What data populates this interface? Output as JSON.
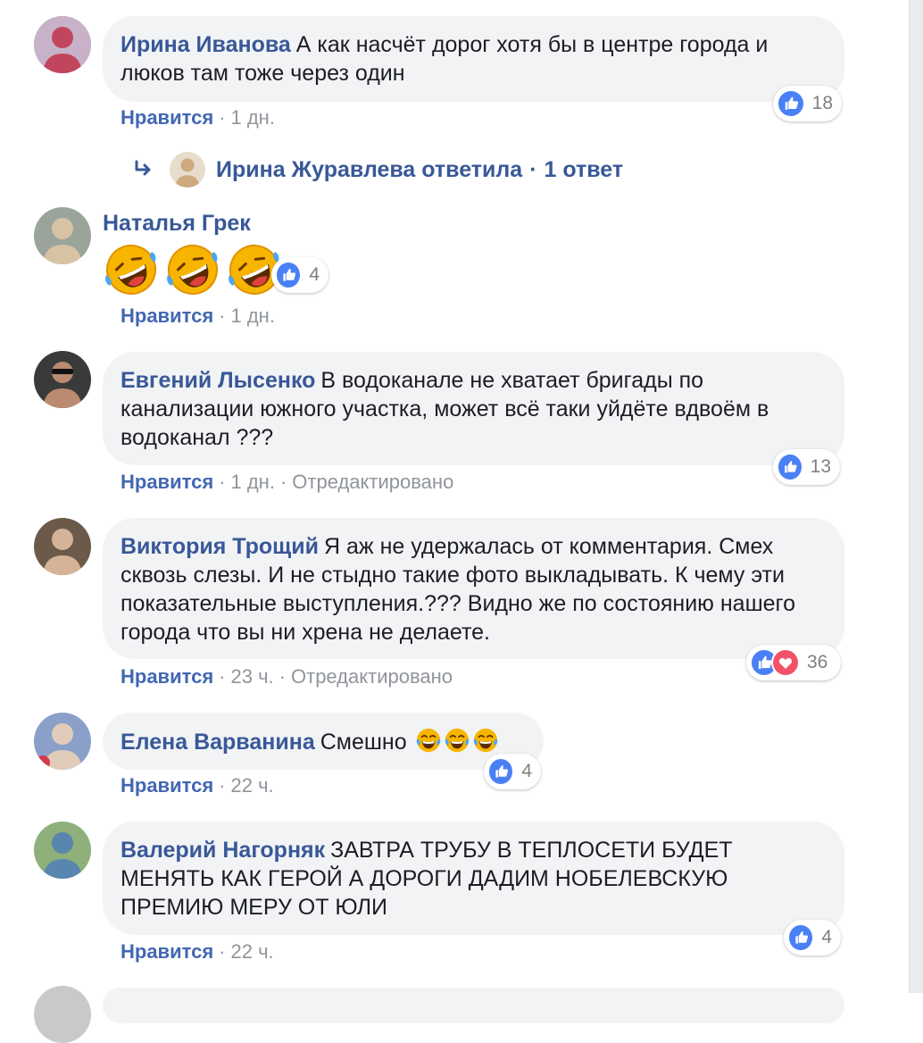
{
  "comments": [
    {
      "author": "Ирина Иванова",
      "text": "А как насчёт дорог хотя бы в центре города и люков там тоже через один",
      "like_label": "Нравится",
      "time": "1 дн.",
      "reactions": {
        "count": "18",
        "types": [
          "like"
        ]
      },
      "reply": {
        "text": "Ирина Журавлева ответила",
        "count": "1 ответ"
      }
    },
    {
      "author": "Наталья Грек",
      "text": "",
      "emojis": [
        "rolling-laughing-emoji",
        "rolling-laughing-emoji",
        "rolling-laughing-emoji"
      ],
      "like_label": "Нравится",
      "time": "1 дн.",
      "reactions": {
        "count": "4",
        "types": [
          "like"
        ]
      }
    },
    {
      "author": "Евгений Лысенко",
      "text": "В водоканале не хватает бригады по канализации южного участка, может всё таки уйдёте вдвоём в водоканал ???",
      "like_label": "Нравится",
      "time": "1 дн.",
      "edited": "Отредактировано",
      "reactions": {
        "count": "13",
        "types": [
          "like"
        ]
      }
    },
    {
      "author": "Виктория Трощий",
      "text": "Я аж не удержалась от комментария. Смех сквозь слезы. И не стыдно такие фото выкладывать. К чему эти показательные выступления.??? Видно же по состоянию нашего города что вы ни хрена не делаете.",
      "like_label": "Нравится",
      "time": "23 ч.",
      "edited": "Отредактировано",
      "reactions": {
        "count": "36",
        "types": [
          "like",
          "love"
        ]
      }
    },
    {
      "author": "Елена Варванина",
      "text": "Смешно",
      "emojis": [
        "tears-of-joy-emoji",
        "tears-of-joy-emoji",
        "tears-of-joy-emoji"
      ],
      "like_label": "Нравится",
      "time": "22 ч.",
      "reactions": {
        "count": "4",
        "types": [
          "like"
        ]
      }
    },
    {
      "author": "Валерий Нагорняк",
      "text": "ЗАВТРА ТРУБУ В ТЕПЛОСЕТИ БУДЕТ МЕНЯТЬ КАК ГЕРОЙ А ДОРОГИ ДАДИМ НОБЕЛЕВСКУЮ ПРЕМИЮ МЕРУ ОТ ЮЛИ",
      "like_label": "Нравится",
      "time": "22 ч.",
      "reactions": {
        "count": "4",
        "types": [
          "like"
        ]
      }
    }
  ],
  "separator": "·",
  "colors": {
    "link": "#385898",
    "bubble": "#f2f3f5",
    "meta": "#90949c",
    "like": "#4a80f5",
    "love": "#f25268"
  }
}
